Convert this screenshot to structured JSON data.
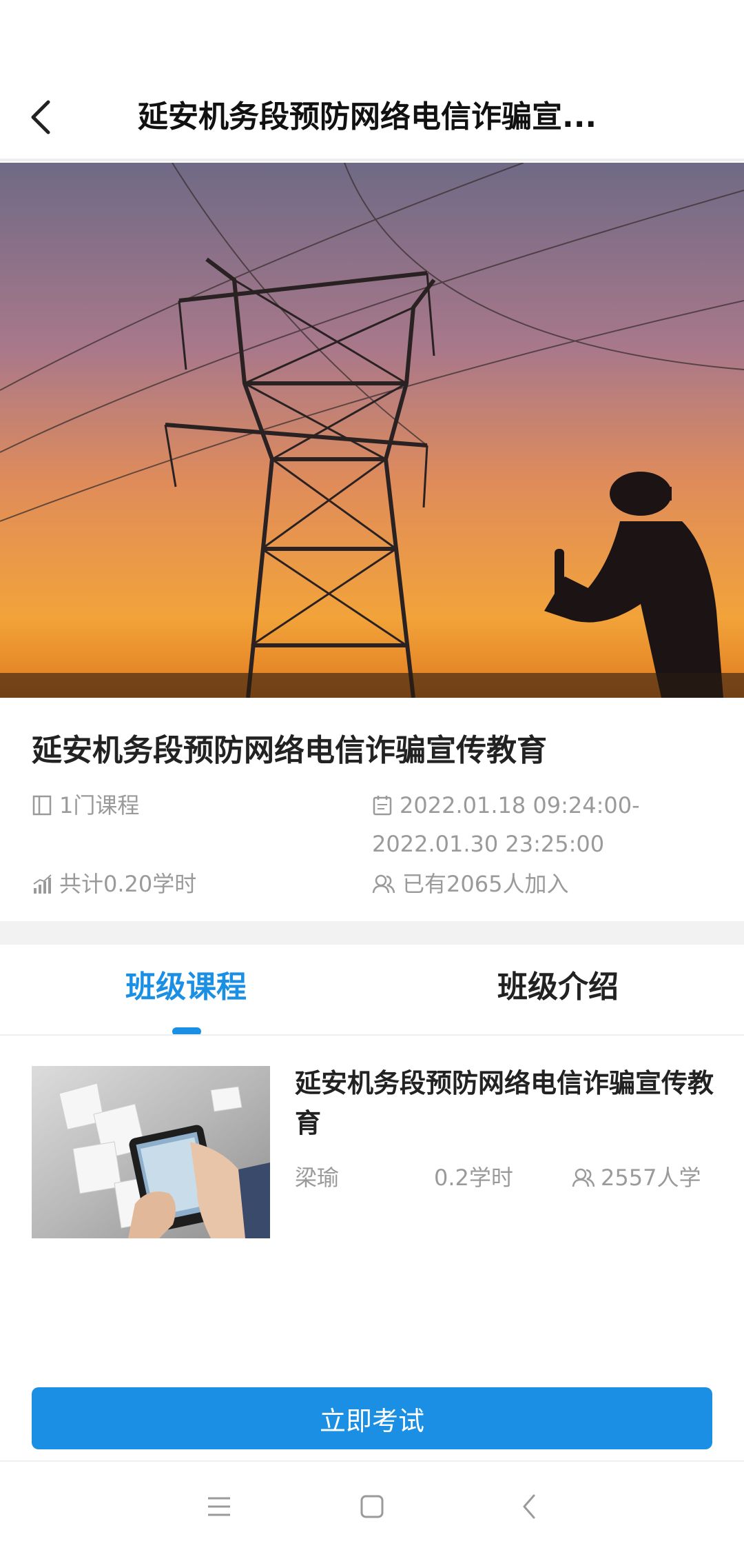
{
  "header": {
    "title": "延安机务段预防网络电信诈骗宣..."
  },
  "class_info": {
    "title": "延安机务段预防网络电信诈骗宣传教育",
    "courses": "1门课程",
    "date_start": "2022.01.18 09:24:00-",
    "date_end": "2022.01.30 23:25:00",
    "hours": "共计0.20学时",
    "joined": "已有2065人加入"
  },
  "tabs": [
    {
      "label": "班级课程",
      "active": true
    },
    {
      "label": "班级介绍",
      "active": false
    }
  ],
  "course": {
    "title": "延安机务段预防网络电信诈骗宣传教育",
    "teacher": "梁瑜",
    "hours": "0.2学时",
    "learners": "2557人学"
  },
  "actions": {
    "exam_label": "立即考试"
  },
  "icons": {
    "back": "chevron-left-icon",
    "courses": "book-icon",
    "date": "calendar-icon",
    "hours": "bar-chart-icon",
    "joined": "users-icon",
    "learners": "users-icon"
  },
  "colors": {
    "accent": "#1a8fe3",
    "meta_text": "#9a9a9a",
    "title_text": "#222222"
  }
}
